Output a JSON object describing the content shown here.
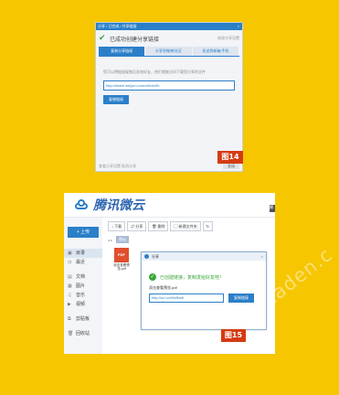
{
  "fig14": {
    "title_bar": "分享 / 已完成 / 共享链接",
    "close_glyph": "×",
    "success_message": "已成功创建分享链接",
    "success_hint": "修改分享设置",
    "tabs": [
      "复制分享链接",
      "分享到微博/社区",
      "发送到邮箱/手机"
    ],
    "description": "您可以将链接复制后发给好友，他们就能访问下载您分享的文件",
    "link": "http://share.weiyun.com/c6e4c0b",
    "copy_button": "复制链接",
    "footer_left": "查看分享设置  取消分享",
    "close_button": "关闭",
    "badge": "图14"
  },
  "fig15": {
    "brand": "腾讯微云",
    "edge_tag": "腾",
    "upload_button": "+ 上传",
    "nav": [
      {
        "icon": "▣",
        "label": "目录"
      },
      {
        "icon": "◷",
        "label": "最近"
      },
      {
        "icon": "▤",
        "label": "文档"
      },
      {
        "icon": "▦",
        "label": "图片"
      },
      {
        "icon": "♫",
        "label": "音乐"
      },
      {
        "icon": "▶",
        "label": "视频"
      },
      {
        "icon": "⧉",
        "label": "剪贴板"
      },
      {
        "icon": "🗑",
        "label": "回收站"
      }
    ],
    "toolbar": [
      "↓ 下载",
      "⇄ 分享",
      "🗑 删除",
      "▢ 新建文件夹",
      "↻"
    ],
    "crumb_arrows": "◂ ▸",
    "crumb_current": "微云",
    "file": {
      "type": "PDF",
      "name": "双击查看预览.pdf"
    },
    "modal": {
      "title": "分享",
      "close_glyph": "×",
      "success": "已创建链接，复制发给好友吧！",
      "file_name": "双击查看预览.pdf",
      "link": "http://url.cn/Wd9wdl",
      "copy_button": "复制链接"
    },
    "badge": "图15"
  },
  "watermark": "naden.c"
}
